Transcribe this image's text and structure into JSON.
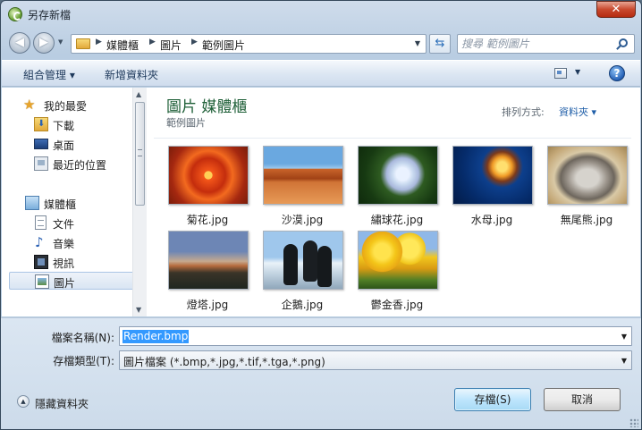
{
  "window": {
    "title": "另存新檔",
    "close_label": "✕"
  },
  "address": {
    "breadcrumbs": [
      "媒體櫃",
      "圖片",
      "範例圖片"
    ],
    "search_placeholder": "搜尋 範例圖片"
  },
  "toolbar": {
    "organize": "組合管理 ▾",
    "new_folder": "新增資料夾",
    "help": "?"
  },
  "navpane": {
    "favorites": {
      "label": "我的最愛",
      "icon": "star-icon"
    },
    "favorites_items": [
      {
        "label": "下載",
        "icon": "downloads-folder-icon"
      },
      {
        "label": "桌面",
        "icon": "desktop-icon"
      },
      {
        "label": "最近的位置",
        "icon": "recent-places-icon"
      }
    ],
    "libraries": {
      "label": "媒體櫃",
      "icon": "libraries-icon"
    },
    "library_items": [
      {
        "label": "文件",
        "icon": "documents-icon"
      },
      {
        "label": "音樂",
        "icon": "music-icon"
      },
      {
        "label": "視訊",
        "icon": "videos-icon"
      },
      {
        "label": "圖片",
        "icon": "pictures-icon",
        "selected": true
      }
    ]
  },
  "content": {
    "title": "圖片 媒體櫃",
    "subtitle": "範例圖片",
    "arrange_label": "排列方式:",
    "arrange_value": "資料夾 ▾",
    "files": [
      {
        "name": "菊花.jpg",
        "thumb": "chrysanthemum"
      },
      {
        "name": "沙漠.jpg",
        "thumb": "desert"
      },
      {
        "name": "繡球花.jpg",
        "thumb": "hydrangea"
      },
      {
        "name": "水母.jpg",
        "thumb": "jellyfish"
      },
      {
        "name": "無尾熊.jpg",
        "thumb": "koala"
      },
      {
        "name": "燈塔.jpg",
        "thumb": "lighthouse"
      },
      {
        "name": "企鵝.jpg",
        "thumb": "penguins"
      },
      {
        "name": "鬱金香.jpg",
        "thumb": "tulips"
      }
    ]
  },
  "form": {
    "filename_label": "檔案名稱(N):",
    "filename_value": "Render.bmp",
    "filetype_label": "存檔類型(T):",
    "filetype_value": "圖片檔案 (*.bmp,*.jpg,*.tif,*.tga,*.png)"
  },
  "footer": {
    "hide_folders": "隱藏資料夾",
    "save": "存檔(S)",
    "cancel": "取消"
  },
  "colors": {
    "selection": "#3399ff",
    "library_title": "#1e5f37",
    "link": "#1f5ea8"
  }
}
